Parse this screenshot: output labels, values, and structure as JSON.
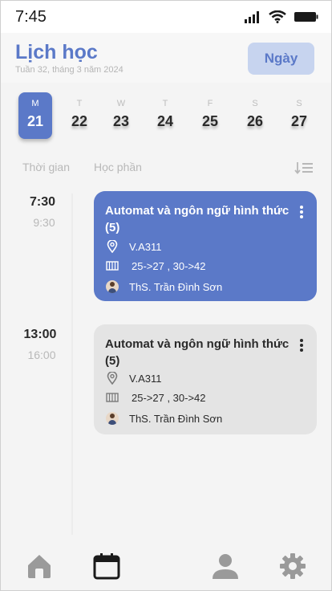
{
  "status_bar": {
    "time": "7:45"
  },
  "header": {
    "title": "Lịch học",
    "subtitle": "Tuần 32, tháng 3 năm 2024",
    "view_button": "Ngày"
  },
  "week": [
    {
      "name": "M",
      "date": "21",
      "active": true
    },
    {
      "name": "T",
      "date": "22"
    },
    {
      "name": "W",
      "date": "23"
    },
    {
      "name": "T",
      "date": "24"
    },
    {
      "name": "F",
      "date": "25"
    },
    {
      "name": "S",
      "date": "26"
    },
    {
      "name": "S",
      "date": "27"
    }
  ],
  "columns": {
    "time": "Thời gian",
    "course": "Học phần"
  },
  "sessions": [
    {
      "start": "7:30",
      "end": "9:30",
      "title": "Automat và ngôn ngữ hình thức (5)",
      "room": "V.A311",
      "weeks": "25->27 , 30->42",
      "teacher": "ThS. Trần Đình Sơn",
      "style": "blue"
    },
    {
      "start": "13:00",
      "end": "16:00",
      "title": "Automat và ngôn ngữ hình thức (5)",
      "room": "V.A311",
      "weeks": "25->27 , 30->42",
      "teacher": "ThS. Trần Đình Sơn",
      "style": "gray"
    }
  ],
  "colors": {
    "accent": "#5b79c8",
    "accent_light": "#c7d4ef",
    "card_gray": "#e4e4e4",
    "nav_icon": "#9a9a9a"
  },
  "nav": {
    "active": "calendar-icon",
    "items": [
      "home-icon",
      "calendar-icon",
      "user-icon",
      "gear-icon"
    ]
  }
}
